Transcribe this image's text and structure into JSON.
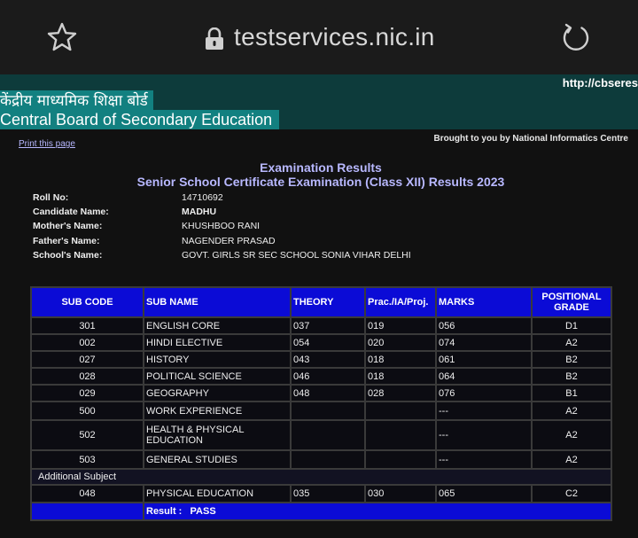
{
  "browser": {
    "url": "testservices.nic.in"
  },
  "banner": {
    "hindi": "केंद्रीय माध्यमिक शिक्षा बोर्ड",
    "english": "Central Board of Secondary Education",
    "site_url": "http://cbseres"
  },
  "links": {
    "print": "Print this page",
    "brought_by": "Brought to you by National Informatics Centre"
  },
  "titles": {
    "line1": "Examination Results",
    "line2": "Senior School Certificate Examination (Class XII) Results 2023"
  },
  "candidate": [
    {
      "label": "Roll No:",
      "value": "14710692"
    },
    {
      "label": "Candidate Name:",
      "value": "MADHU"
    },
    {
      "label": "Mother's Name:",
      "value": "KHUSHBOO RANI"
    },
    {
      "label": "Father's Name:",
      "value": "NAGENDER PRASAD"
    },
    {
      "label": "School's Name:",
      "value": "GOVT. GIRLS SR SEC SCHOOL SONIA VIHAR DELHI"
    }
  ],
  "table": {
    "headers": [
      "SUB CODE",
      "SUB NAME",
      "THEORY",
      "Prac./IA/Proj.",
      "MARKS",
      "POSITIONAL GRADE"
    ],
    "rows": [
      {
        "code": "301",
        "name": "ENGLISH CORE",
        "theory": "037",
        "prac": "019",
        "marks": "056",
        "grade": "D1"
      },
      {
        "code": "002",
        "name": "HINDI ELECTIVE",
        "theory": "054",
        "prac": "020",
        "marks": "074",
        "grade": "A2"
      },
      {
        "code": "027",
        "name": "HISTORY",
        "theory": "043",
        "prac": "018",
        "marks": "061",
        "grade": "B2"
      },
      {
        "code": "028",
        "name": "POLITICAL SCIENCE",
        "theory": "046",
        "prac": "018",
        "marks": "064",
        "grade": "B2"
      },
      {
        "code": "029",
        "name": "GEOGRAPHY",
        "theory": "048",
        "prac": "028",
        "marks": "076",
        "grade": "B1"
      },
      {
        "code": "500",
        "name": "WORK EXPERIENCE",
        "theory": "",
        "prac": "",
        "marks": "---",
        "grade": "A2"
      },
      {
        "code": "502",
        "name": "HEALTH & PHYSICAL EDUCATION",
        "theory": "",
        "prac": "",
        "marks": "---",
        "grade": "A2"
      },
      {
        "code": "503",
        "name": "GENERAL STUDIES",
        "theory": "",
        "prac": "",
        "marks": "---",
        "grade": "A2"
      }
    ],
    "additional_label": "Additional Subject",
    "additional": {
      "code": "048",
      "name": "PHYSICAL EDUCATION",
      "theory": "035",
      "prac": "030",
      "marks": "065",
      "grade": "C2"
    },
    "result_label": "Result :",
    "result_value": "PASS"
  },
  "icons": [
    "star-icon",
    "lock-icon",
    "reload-icon"
  ]
}
